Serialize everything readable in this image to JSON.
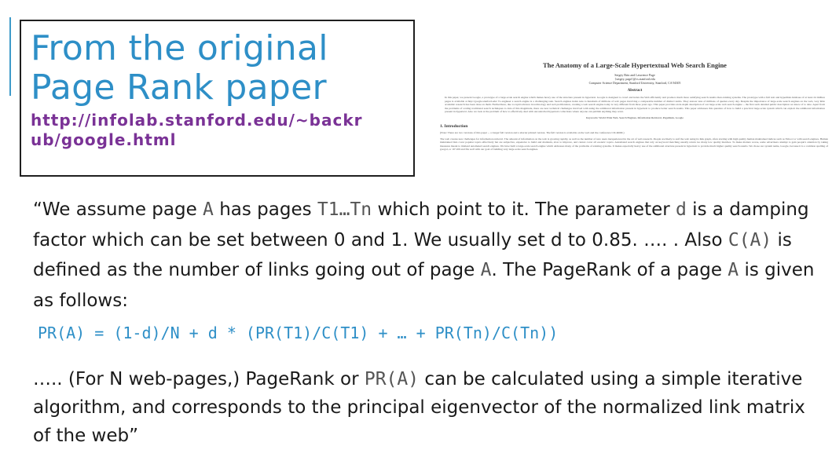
{
  "title_box": {
    "line1": "From the original",
    "line2": "Page Rank paper",
    "url_line1": "http://infolab.stanford.edu/~backr",
    "url_line2": "ub/google.html"
  },
  "paper_thumbnail": {
    "title": "The Anatomy of a Large-Scale Hypertextual Web Search Engine",
    "authors": "Sergey Brin and Lawrence Page",
    "emails": "{sergey, page}@cs.stanford.edu",
    "affiliation": "Computer Science Department, Stanford University, Stanford, CA 94305",
    "abstract_heading": "Abstract",
    "abstract_text": "In this paper, we present Google, a prototype of a large-scale search engine which makes heavy use of the structure present in hypertext. Google is designed to crawl and index the Web efficiently and produce much more satisfying search results than existing systems. The prototype with a full text and hyperlink database of at least 24 million pages is available at http://google.stanford.edu/ To engineer a search engine is a challenging task. Search engines index tens to hundreds of millions of web pages involving a comparable number of distinct terms. They answer tens of millions of queries every day. Despite the importance of large-scale search engines on the web, very little academic research has been done on them. Furthermore, due to rapid advance in technology and web proliferation, creating a web search engine today is very different from three years ago. This paper provides an in-depth description of our large-scale web search engine -- the first such detailed public description we know of to date. Apart from the problems of scaling traditional search techniques to data of this magnitude, there are new technical challenges involved with using the additional information present in hypertext to produce better search results. This paper addresses this question of how to build a practical large-scale system which can exploit the additional information present in hypertext. Also we look at the problem of how to effectively deal with uncontrolled hypertext collections where anyone can publish anything they want.",
    "keywords": "Keywords: World Wide Web, Search Engines, Information Retrieval, PageRank, Google",
    "section_heading": "1. Introduction",
    "intro_note": "(Note: There are two versions of this paper -- a longer full version and a shorter printed version. The full version is available on the web and the conference CD-ROM.)",
    "intro_text": "The web creates new challenges for information retrieval. The amount of information on the web is growing rapidly, as well as the number of new users inexperienced in the art of web research. People are likely to surf the web using its link graph, often starting with high quality human maintained indices such as Yahoo! or with search engines. Human maintained lists cover popular topics effectively but are subjective, expensive to build and maintain, slow to improve, and cannot cover all esoteric topics. Automated search engines that rely on keyword matching usually return too many low quality matches. To make matters worse, some advertisers attempt to gain people's attention by taking measures meant to mislead automated search engines. We have built a large-scale search engine which addresses many of the problems of existing systems. It makes especially heavy use of the additional structure present in hypertext to provide much higher quality search results. We chose our system name, Google, because it is a common spelling of googol, or 10^100 and fits well with our goal of building very large-scale search engines."
  },
  "quote": {
    "p1": "“We assume page ",
    "c1": "A",
    "p2": " has pages ",
    "c2": "T1…Tn",
    "p3": " which point to it. The parameter ",
    "c3": "d",
    "p4": " is a damping factor which can be set between 0 and 1. We usually set d to 0.85. …. . Also ",
    "c4": "C(A)",
    "p5": " is defined as the number of links going out of page ",
    "c5": "A",
    "p6": ". The PageRank of a page ",
    "c6": "A",
    "p7": " is given as follows:"
  },
  "formula": "PR(A) = (1-d)/N + d * (PR(T1)/C(T1) + … + PR(Tn)/C(Tn))",
  "conclusion": {
    "p1": "….. (For N web-pages,) PageRank or ",
    "c1": "PR(A)",
    "p2": " can be calculated using a simple iterative algorithm, and corresponds to the principal eigenvector of the normalized link matrix of the web”"
  }
}
